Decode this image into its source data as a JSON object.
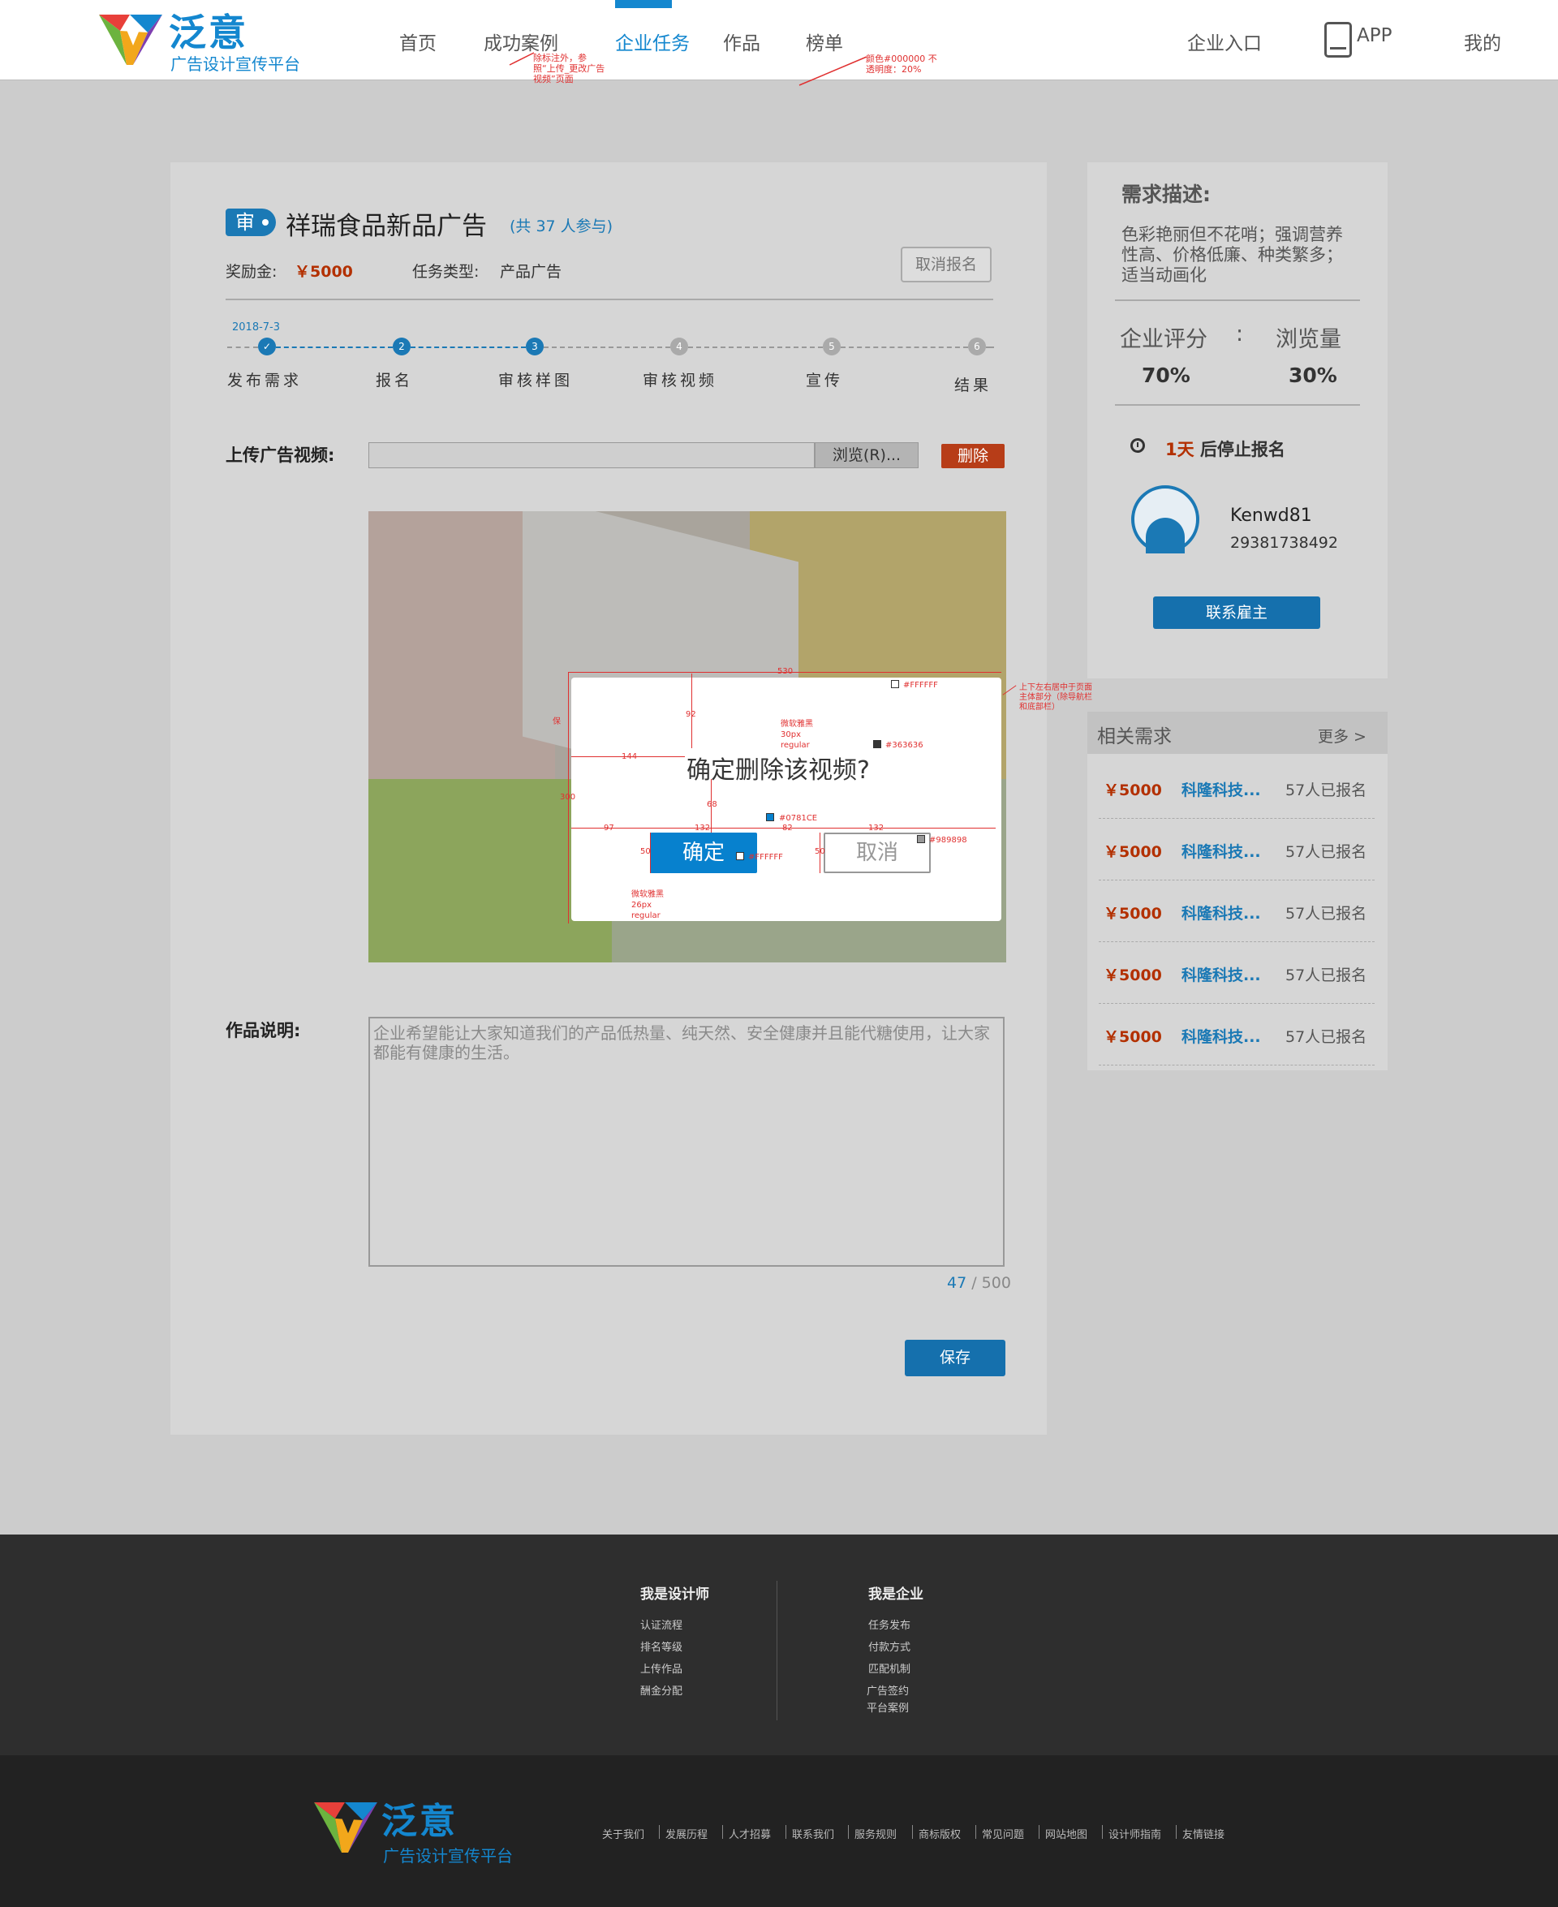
{
  "header": {
    "brand_name": "泛意",
    "brand_slogan": "广告设计宣传平台",
    "nav": {
      "home": "首页",
      "cases": "成功案例",
      "tasks": "企业任务",
      "works": "作品",
      "ranking": "榜单"
    },
    "enterprise_entry": "企业入口",
    "app_label": "APP",
    "mine": "我的",
    "notes": {
      "note1": "除标注外，参照“上传_更改广告视频”页面",
      "note2": "颜色#000000 不透明度：20%"
    }
  },
  "task": {
    "badge": "审",
    "title": "祥瑞食品新品广告",
    "participants": "(共 37 人参与)",
    "reward_label": "奖励金:",
    "reward_value": "￥5000",
    "type_label": "任务类型:",
    "type_value": "产品广告",
    "cancel_signup": "取消报名"
  },
  "progress": {
    "date": "2018-7-3",
    "current_step": 3,
    "steps": [
      {
        "num": "✓",
        "label": "发布需求"
      },
      {
        "num": "2",
        "label": "报名"
      },
      {
        "num": "3",
        "label": "审核样图"
      },
      {
        "num": "4",
        "label": "审核视频"
      },
      {
        "num": "5",
        "label": "宣传"
      },
      {
        "num": "6",
        "label": "结果"
      }
    ]
  },
  "upload": {
    "label": "上传广告视频:",
    "browse": "浏览(R)...",
    "delete": "删除"
  },
  "modal": {
    "message": "确定删除该视频?",
    "confirm": "确定",
    "cancel": "取消",
    "annotations": {
      "width": "530",
      "height": "300",
      "gap_top": "92",
      "gap_left": "144",
      "gap_mid": "68",
      "btn_left": "97",
      "btn_w": "132",
      "btn_gap": "82",
      "btn_w2": "132",
      "btn_h": "50",
      "btn_h2": "50",
      "bg_color": "#FFFFFF",
      "text_color": "#363636",
      "confirm_color": "#0781CE",
      "confirm_text_color": "#FFFFFF",
      "cancel_color": "#989898",
      "font_note_1": "微软雅黑 30px regular",
      "font_note_2": "微软雅黑 26px regular",
      "side_note": "上下左右居中于页面主体部分（除导航栏和底部栏）",
      "mark_label": "保"
    }
  },
  "description": {
    "label": "作品说明:",
    "text": "企业希望能让大家知道我们的产品低热量、纯天然、安全健康并且能代糖使用，让大家都能有健康的生活。",
    "count_current": "47",
    "count_max": "/ 500",
    "save": "保存"
  },
  "sidebar": {
    "req_heading": "需求描述:",
    "req_text": "色彩艳丽但不花哨；强调营养性高、价格低廉、种类繁多；适当动画化",
    "metric_left_label": "企业评分",
    "metric_sep": ":",
    "metric_right_label": "浏览量",
    "metric_left_value": "70%",
    "metric_right_value": "30%",
    "deadline_days": "1天",
    "deadline_text": "后停止报名",
    "user_name": "Kenwd81",
    "user_phone": "29381738492",
    "contact": "联系雇主"
  },
  "related": {
    "title": "相关需求",
    "more": "更多 >",
    "items": [
      {
        "price": "￥5000",
        "name": "科隆科技...",
        "count": "57人已报名"
      },
      {
        "price": "￥5000",
        "name": "科隆科技...",
        "count": "57人已报名"
      },
      {
        "price": "￥5000",
        "name": "科隆科技...",
        "count": "57人已报名"
      },
      {
        "price": "￥5000",
        "name": "科隆科技...",
        "count": "57人已报名"
      },
      {
        "price": "￥5000",
        "name": "科隆科技...",
        "count": "57人已报名"
      }
    ]
  },
  "footer": {
    "designer": {
      "title": "我是设计师",
      "items": [
        "认证流程",
        "排名等级",
        "上传作品",
        "酬金分配"
      ]
    },
    "enterprise": {
      "title": "我是企业",
      "items": [
        "任务发布",
        "付款方式",
        "匹配机制",
        "广告签约",
        "平台案例"
      ]
    },
    "brand_name": "泛意",
    "brand_slogan": "广告设计宣传平台",
    "links": [
      "关于我们",
      "发展历程",
      "人才招募",
      "联系我们",
      "服务规则",
      "商标版权",
      "常见问题",
      "网站地图",
      "设计师指南",
      "友情链接"
    ]
  },
  "colors": {
    "brand_blue": "#1487cf",
    "confirm_blue": "#0781ce",
    "danger": "#b33000",
    "overlay": "#000000"
  }
}
